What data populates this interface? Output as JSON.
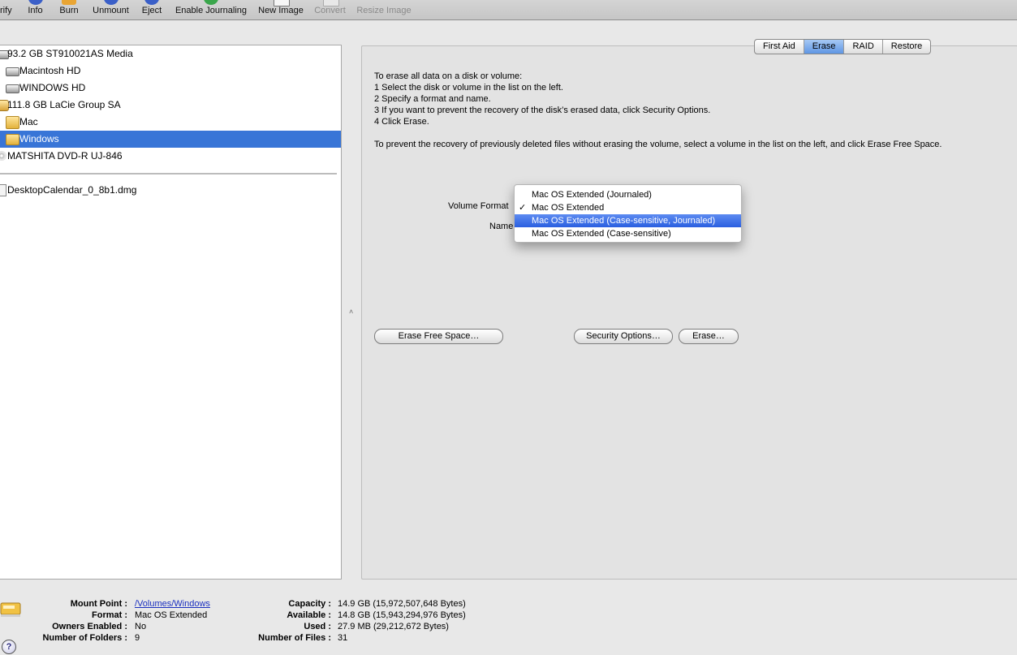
{
  "toolbar": {
    "items": [
      {
        "label": "rify",
        "icon": "verify-icon",
        "disabled": false
      },
      {
        "label": "Info",
        "icon": "info-icon",
        "disabled": false
      },
      {
        "label": "Burn",
        "icon": "burn-icon",
        "disabled": false
      },
      {
        "label": "Unmount",
        "icon": "unmount-icon",
        "disabled": false
      },
      {
        "label": "Eject",
        "icon": "eject-icon",
        "disabled": false
      },
      {
        "label": "Enable Journaling",
        "icon": "journaling-icon",
        "disabled": false
      },
      {
        "label": "New Image",
        "icon": "new-image-icon",
        "disabled": false
      },
      {
        "label": "Convert",
        "icon": "convert-icon",
        "disabled": true
      },
      {
        "label": "Resize Image",
        "icon": "resize-image-icon",
        "disabled": true
      }
    ]
  },
  "sidebar": {
    "items": [
      {
        "label": "93.2 GB ST910021AS Media",
        "icon": "hard-disk-icon",
        "selected": false
      },
      {
        "label": "Macintosh HD",
        "icon": "hard-drive-volume-icon",
        "selected": false
      },
      {
        "label": "WINDOWS HD",
        "icon": "hard-drive-volume-icon",
        "selected": false
      },
      {
        "label": "111.8 GB LaCie Group SA",
        "icon": "external-disk-icon",
        "selected": false
      },
      {
        "label": "Mac",
        "icon": "external-volume-icon",
        "selected": false
      },
      {
        "label": "Windows",
        "icon": "external-volume-icon",
        "selected": true
      },
      {
        "label": "MATSHITA DVD-R UJ-846",
        "icon": "optical-drive-icon",
        "selected": false
      }
    ],
    "images": [
      {
        "label": "DesktopCalendar_0_8b1.dmg",
        "icon": "disk-image-icon"
      }
    ]
  },
  "tabs": [
    {
      "label": "First Aid",
      "active": false
    },
    {
      "label": "Erase",
      "active": true
    },
    {
      "label": "RAID",
      "active": false
    },
    {
      "label": "Restore",
      "active": false
    }
  ],
  "erase": {
    "instructions": [
      "To erase all data on a disk or volume:",
      "1 Select the disk or volume in the list on the left.",
      "2 Specify a format and name.",
      "3 If you want to prevent the recovery of the disk’s erased data, click Security Options.",
      "4 Click Erase."
    ],
    "free_space_note": "To prevent the recovery of previously deleted files without erasing the volume, select a volume in the list on the left, and click Erase Free Space.",
    "volume_format_label": "Volume Format",
    "name_label": "Name",
    "format_options": [
      {
        "label": "Mac OS Extended (Journaled)",
        "checked": false,
        "highlighted": false
      },
      {
        "label": "Mac OS Extended",
        "checked": true,
        "highlighted": false
      },
      {
        "label": "Mac OS Extended (Case-sensitive, Journaled)",
        "checked": false,
        "highlighted": true
      },
      {
        "label": "Mac OS Extended (Case-sensitive)",
        "checked": false,
        "highlighted": false
      }
    ],
    "checkmark": "✓",
    "erase_free_space_button": "Erase Free Space…",
    "security_options_button": "Security Options…",
    "erase_button": "Erase…"
  },
  "info": {
    "mount_point_label": "Mount Point :",
    "mount_point": "/Volumes/Windows",
    "format_label": "Format :",
    "format": "Mac OS Extended",
    "owners_label": "Owners Enabled :",
    "owners": "No",
    "folders_label": "Number of Folders :",
    "folders": "9",
    "capacity_label": "Capacity :",
    "capacity": "14.9 GB (15,972,507,648 Bytes)",
    "available_label": "Available :",
    "available": "14.8 GB (15,943,294,976 Bytes)",
    "used_label": "Used :",
    "used": "27.9 MB (29,212,672 Bytes)",
    "files_label": "Number of Files :",
    "files": "31"
  },
  "help_glyph": "?",
  "splitter_glyph": "˄",
  "colors": {
    "selection": "#3875d7",
    "menu_highlight": "#2a5fe0",
    "link": "#1a2fbf"
  }
}
